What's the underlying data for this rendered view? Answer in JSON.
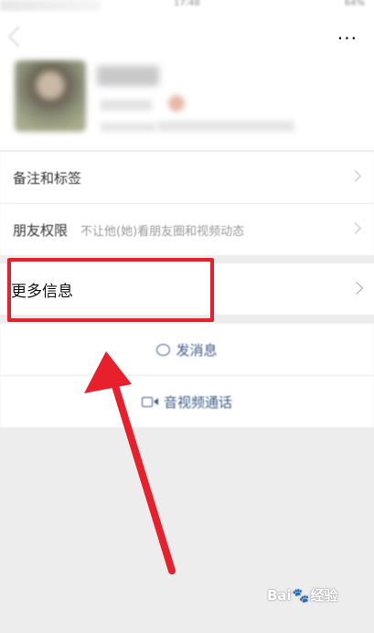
{
  "status_bar": {
    "time": "17:48",
    "battery": "64%"
  },
  "header": {
    "more_label": "···"
  },
  "rows": {
    "remarks_label": "备注和标签",
    "moments_label": "朋友权限",
    "moments_desc": "不让他(她)看朋友圈和视频动态",
    "more_info_label": "更多信息"
  },
  "actions": {
    "message_label": "发消息",
    "call_label": "音视频通话"
  },
  "watermark": {
    "left": "Bai",
    "right": "经验"
  },
  "colors": {
    "highlight": "#e8202c",
    "link": "#3b5a88",
    "background": "#ededed"
  },
  "icons": [
    "back-icon",
    "more-icon",
    "chevron-right-icon",
    "message-icon",
    "video-call-icon",
    "baidu-paw-icon"
  ]
}
